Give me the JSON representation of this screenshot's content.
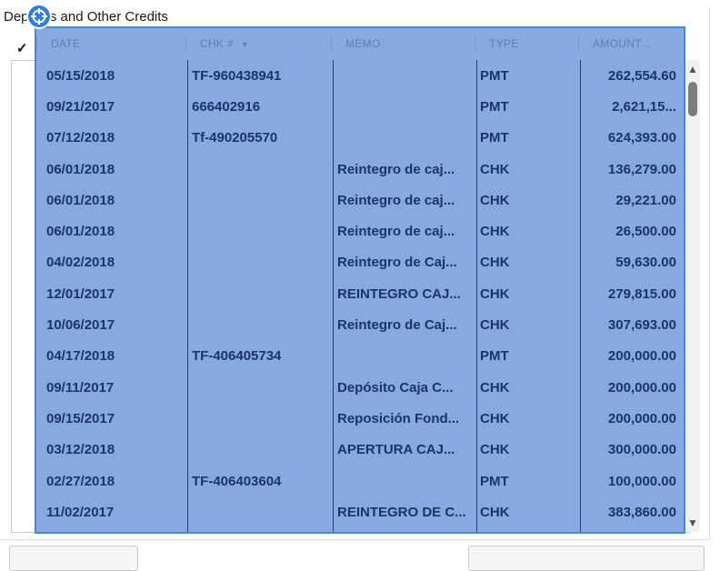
{
  "panel": {
    "title": "Deposits and Other Credits",
    "check_column_glyph": "✓"
  },
  "table": {
    "columns": [
      "DATE",
      "CHK #",
      "MEMO",
      "TYPE",
      "AMOUNT..."
    ],
    "sort_indicator": "▼",
    "rows": [
      {
        "date": "05/15/2018",
        "chk": "TF-960438941",
        "memo": "",
        "type": "PMT",
        "amount": "262,554.60"
      },
      {
        "date": "09/21/2017",
        "chk": "666402916",
        "memo": "",
        "type": "PMT",
        "amount": "2,621,15..."
      },
      {
        "date": "07/12/2018",
        "chk": "Tf-490205570",
        "memo": "",
        "type": "PMT",
        "amount": "624,393.00"
      },
      {
        "date": "06/01/2018",
        "chk": "",
        "memo": "Reintegro de caj...",
        "type": "CHK",
        "amount": "136,279.00"
      },
      {
        "date": "06/01/2018",
        "chk": "",
        "memo": "Reintegro de caj...",
        "type": "CHK",
        "amount": "29,221.00"
      },
      {
        "date": "06/01/2018",
        "chk": "",
        "memo": "Reintegro de caj...",
        "type": "CHK",
        "amount": "26,500.00"
      },
      {
        "date": "04/02/2018",
        "chk": "",
        "memo": "Reintegro de Caj...",
        "type": "CHK",
        "amount": "59,630.00"
      },
      {
        "date": "12/01/2017",
        "chk": "",
        "memo": "REINTEGRO CAJ...",
        "type": "CHK",
        "amount": "279,815.00"
      },
      {
        "date": "10/06/2017",
        "chk": "",
        "memo": "Reintegro de Caj...",
        "type": "CHK",
        "amount": "307,693.00"
      },
      {
        "date": "04/17/2018",
        "chk": "TF-406405734",
        "memo": "",
        "type": "PMT",
        "amount": "200,000.00"
      },
      {
        "date": "09/11/2017",
        "chk": "",
        "memo": "Depósito Caja C...",
        "type": "CHK",
        "amount": "200,000.00"
      },
      {
        "date": "09/15/2017",
        "chk": "",
        "memo": "Reposición Fond...",
        "type": "CHK",
        "amount": "200,000.00"
      },
      {
        "date": "03/12/2018",
        "chk": "",
        "memo": "APERTURA CAJ...",
        "type": "CHK",
        "amount": "300,000.00"
      },
      {
        "date": "02/27/2018",
        "chk": "TF-406403604",
        "memo": "",
        "type": "PMT",
        "amount": "100,000.00"
      },
      {
        "date": "11/02/2017",
        "chk": "",
        "memo": "REINTEGRO DE C...",
        "type": "CHK",
        "amount": "383,860.00"
      }
    ]
  },
  "scrollbar": {
    "up_glyph": "▲",
    "down_glyph": "▼"
  },
  "colors": {
    "selection_fill": "#86a9e0",
    "selection_border": "#4a86d8",
    "row_text": "#1b3566"
  }
}
